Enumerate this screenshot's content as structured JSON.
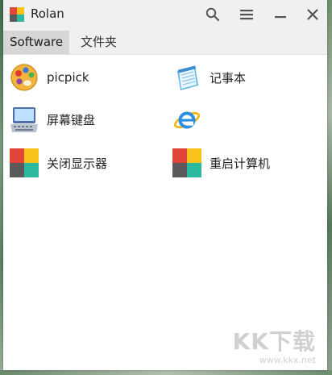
{
  "window": {
    "title": "Rolan",
    "controls": [
      "search-icon",
      "menu-icon",
      "minimize-icon",
      "close-icon"
    ]
  },
  "tabs": [
    {
      "label": "Software",
      "active": true
    },
    {
      "label": "文件夹",
      "active": false
    }
  ],
  "items": [
    {
      "label": "picpick",
      "icon": "picpick-icon"
    },
    {
      "label": "记事本",
      "icon": "notepad-icon"
    },
    {
      "label": "屏幕键盘",
      "icon": "keyboard-icon"
    },
    {
      "label": "",
      "icon": "internet-explorer-icon"
    },
    {
      "label": "关闭显示器",
      "icon": "tiles-icon"
    },
    {
      "label": "重启计算机",
      "icon": "tiles-icon"
    }
  ],
  "watermark": {
    "main": "KK下载",
    "sub": "www.kkx.net"
  },
  "colors": {
    "tile_red": "#e2463a",
    "tile_yellow": "#f7c21a",
    "tile_teal": "#2bb9a0",
    "tile_gray": "#5a5a5a",
    "tab_active_bg": "#d6d6d6"
  }
}
